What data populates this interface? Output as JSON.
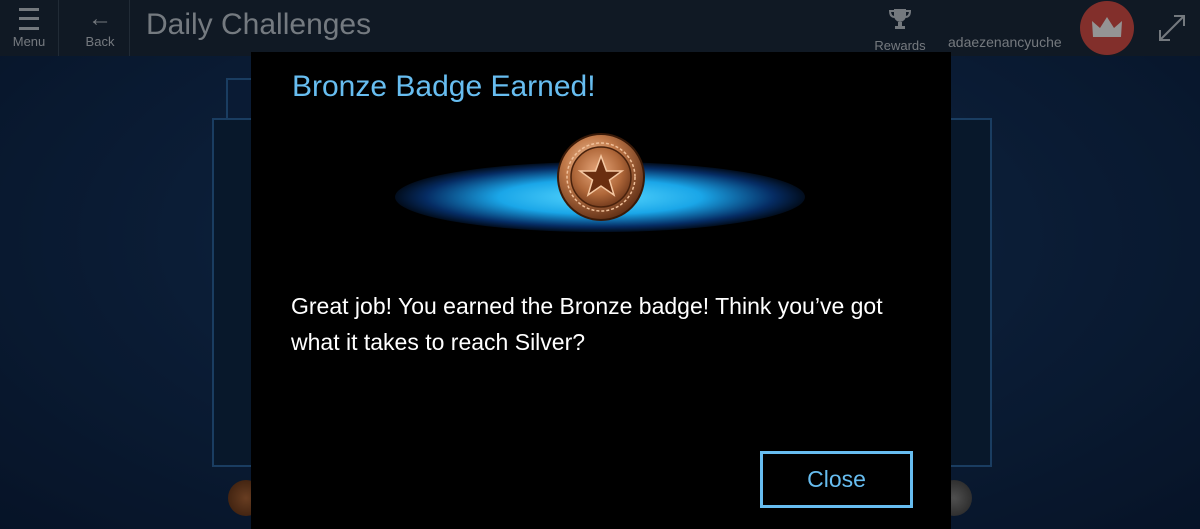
{
  "topbar": {
    "menu_label": "Menu",
    "back_label": "Back",
    "title": "Daily Challenges",
    "rewards_label": "Rewards",
    "username": "adaezenancyuche"
  },
  "modal": {
    "title": "Bronze Badge Earned!",
    "message": "Great job! You earned the Bronze badge! Think you’ve got what it takes to reach Silver?",
    "close_label": "Close",
    "badge_icon": "bronze-star-badge"
  },
  "colors": {
    "accent": "#67bdf0",
    "modal_bg": "#000000",
    "avatar_bg": "#e0524a"
  }
}
